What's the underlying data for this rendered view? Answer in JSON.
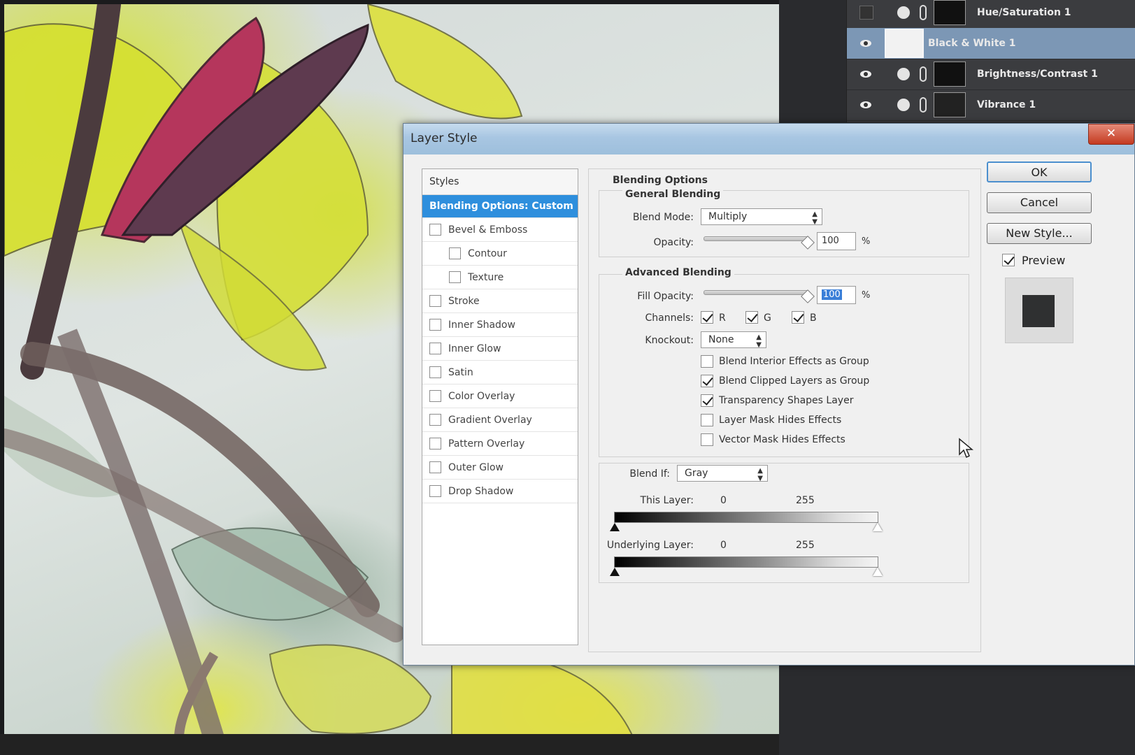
{
  "layers": [
    {
      "name": "Hue/Saturation 1",
      "visible": false,
      "selected": false
    },
    {
      "name": "Black & White 1",
      "visible": true,
      "selected": true
    },
    {
      "name": "Brightness/Contrast 1",
      "visible": true,
      "selected": false
    },
    {
      "name": "Vibrance 1",
      "visible": true,
      "selected": false
    }
  ],
  "dialog": {
    "title": "Layer Style",
    "close_label": "✕"
  },
  "styles": {
    "header": "Styles",
    "items": [
      {
        "label": "Blending Options: Custom",
        "active": true,
        "checkbox": false
      },
      {
        "label": "Bevel & Emboss",
        "checked": false
      },
      {
        "label": "Contour",
        "checked": false,
        "indent": true
      },
      {
        "label": "Texture",
        "checked": false,
        "indent": true
      },
      {
        "label": "Stroke",
        "checked": false
      },
      {
        "label": "Inner Shadow",
        "checked": false
      },
      {
        "label": "Inner Glow",
        "checked": false
      },
      {
        "label": "Satin",
        "checked": false
      },
      {
        "label": "Color Overlay",
        "checked": false
      },
      {
        "label": "Gradient Overlay",
        "checked": false
      },
      {
        "label": "Pattern Overlay",
        "checked": false
      },
      {
        "label": "Outer Glow",
        "checked": false
      },
      {
        "label": "Drop Shadow",
        "checked": false
      }
    ]
  },
  "blending": {
    "section_title": "Blending Options",
    "general_title": "General Blending",
    "blend_mode_label": "Blend Mode:",
    "blend_mode_value": "Multiply",
    "opacity_label": "Opacity:",
    "opacity_value": "100",
    "opacity_level": 1.0,
    "percent": "%",
    "advanced_title": "Advanced Blending",
    "fill_opacity_label": "Fill Opacity:",
    "fill_opacity_value": "100",
    "fill_opacity_level": 1.0,
    "channels_label": "Channels:",
    "channels": [
      {
        "label": "R",
        "checked": true
      },
      {
        "label": "G",
        "checked": true
      },
      {
        "label": "B",
        "checked": true
      }
    ],
    "knockout_label": "Knockout:",
    "knockout_value": "None",
    "options": [
      {
        "label": "Blend Interior Effects as Group",
        "checked": false
      },
      {
        "label": "Blend Clipped Layers as Group",
        "checked": true
      },
      {
        "label": "Transparency Shapes Layer",
        "checked": true
      },
      {
        "label": "Layer Mask Hides Effects",
        "checked": false
      },
      {
        "label": "Vector Mask Hides Effects",
        "checked": false
      }
    ],
    "blend_if_label": "Blend If:",
    "blend_if_value": "Gray",
    "this_layer_label": "This Layer:",
    "this_layer_min": "0",
    "this_layer_max": "255",
    "underlying_label": "Underlying Layer:",
    "underlying_min": "0",
    "underlying_max": "255"
  },
  "buttons": {
    "ok": "OK",
    "cancel": "Cancel",
    "new_style": "New Style...",
    "preview_label": "Preview",
    "preview_checked": true
  },
  "colors": {
    "selected_style": "#2e8fdd",
    "selected_layer": "#7c97b5",
    "preview_swatch": "#2f3031"
  }
}
